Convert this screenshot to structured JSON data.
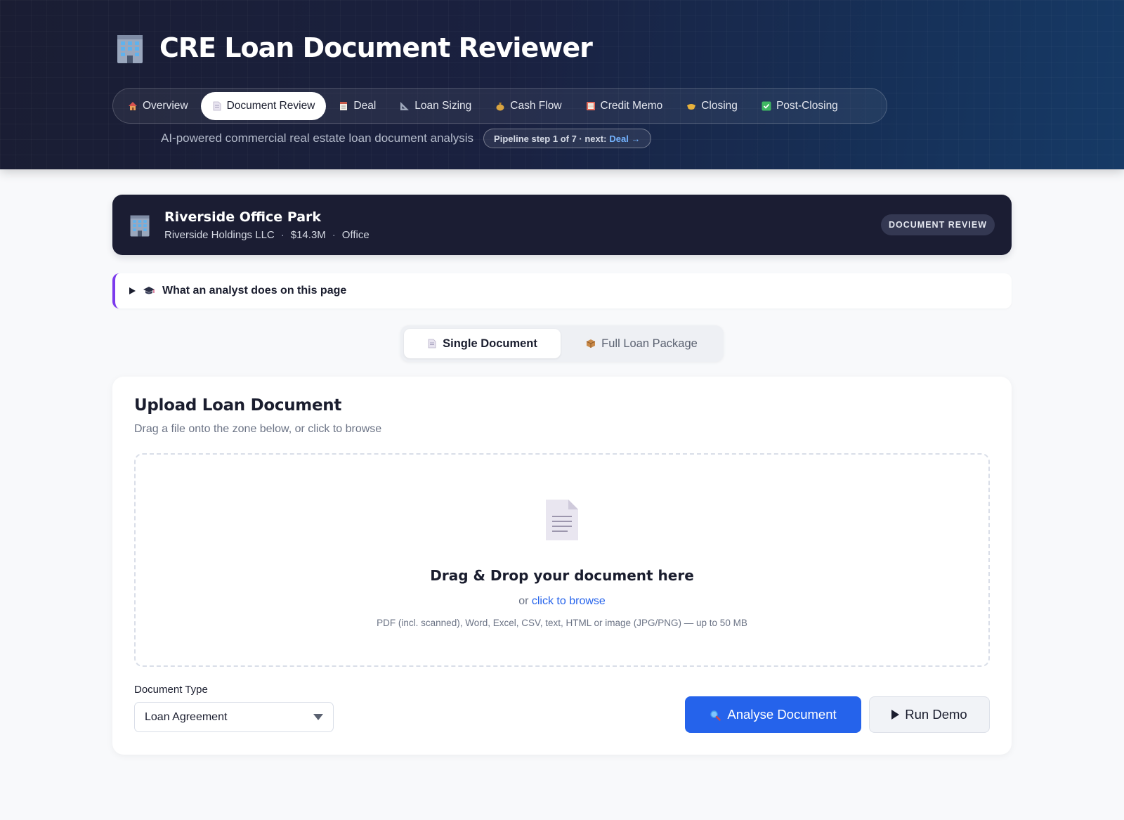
{
  "header": {
    "title": "CRE Loan Document Reviewer",
    "subtitle": "AI-powered commercial real estate loan document analysis",
    "pipeline_prefix": "Pipeline step 1 of 7 · next:",
    "pipeline_next": "Deal →",
    "nav": [
      {
        "label": "Overview",
        "icon": "house-icon",
        "active": false
      },
      {
        "label": "Document Review",
        "icon": "page-icon",
        "active": true
      },
      {
        "label": "Deal",
        "icon": "receipt-icon",
        "active": false
      },
      {
        "label": "Loan Sizing",
        "icon": "ruler-icon",
        "active": false
      },
      {
        "label": "Cash Flow",
        "icon": "money-bag-icon",
        "active": false
      },
      {
        "label": "Credit Memo",
        "icon": "ledger-icon",
        "active": false
      },
      {
        "label": "Closing",
        "icon": "handshake-icon",
        "active": false
      },
      {
        "label": "Post-Closing",
        "icon": "check-box-icon",
        "active": false
      }
    ]
  },
  "deal": {
    "name": "Riverside Office Park",
    "borrower": "Riverside Holdings LLC",
    "amount": "$14.3M",
    "property_type": "Office",
    "separator": "·",
    "stage": "DOCUMENT REVIEW"
  },
  "analyst": {
    "label": "What an analyst does on this page"
  },
  "mode": {
    "single": "Single Document",
    "package": "Full Loan Package"
  },
  "upload": {
    "title": "Upload Loan Document",
    "subtitle": "Drag a file onto the zone below, or click to browse",
    "drop_title": "Drag & Drop your document here",
    "drop_or": "or",
    "drop_browse": "click to browse",
    "formats": "PDF (incl. scanned), Word, Excel, CSV, text, HTML or image (JPG/PNG) — up to 50 MB",
    "doctype_label": "Document Type",
    "doctype_value": "Loan Agreement",
    "analyse_label": "Analyse Document",
    "demo_label": "Run Demo"
  },
  "colors": {
    "accent": "#2563eb",
    "analyst_bar": "#7c3aed",
    "banner": "#1b1d33"
  }
}
